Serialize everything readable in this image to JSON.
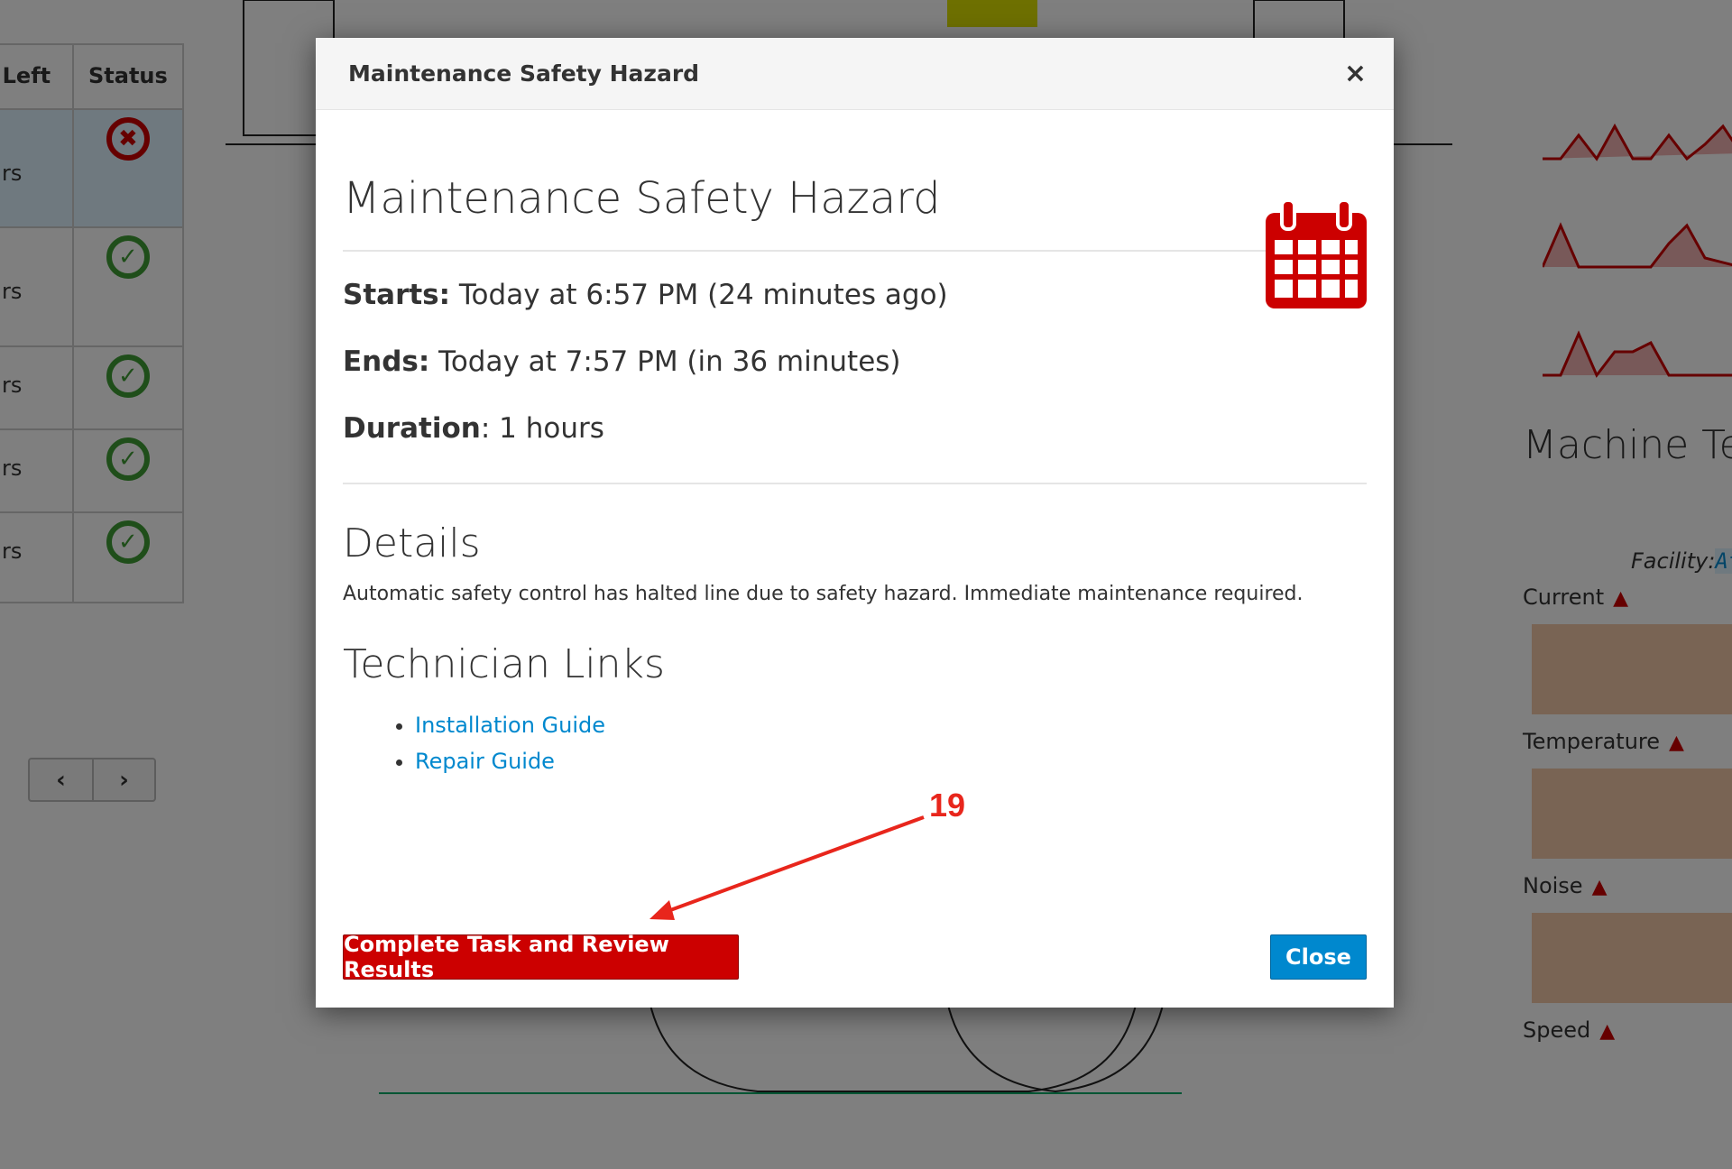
{
  "background": {
    "table": {
      "headers": [
        "e Left",
        "Status"
      ],
      "rows": [
        {
          "time": "rs",
          "status": "error"
        },
        {
          "time": "rs",
          "status": "ok"
        },
        {
          "time": "rs",
          "status": "ok"
        },
        {
          "time": "rs",
          "status": "ok"
        },
        {
          "time": "rs",
          "status": "ok"
        }
      ]
    },
    "pager": {
      "prev": "‹",
      "next": "›"
    },
    "right_panel": {
      "title": "Machine Tel",
      "facility_label": "Facility:",
      "facility_value": "At",
      "metrics": [
        "Current",
        "Temperature",
        "Noise",
        "Speed"
      ]
    }
  },
  "modal": {
    "header_title": "Maintenance Safety Hazard",
    "close_x": "×",
    "title": "Maintenance Safety Hazard",
    "icon": "calendar-icon",
    "starts_label": "Starts:",
    "starts_value": " Today at 6:57 PM (24 minutes ago)",
    "ends_label": "Ends:",
    "ends_value": " Today at 7:57 PM (in 36 minutes)",
    "duration_label": "Duration",
    "duration_value": ": 1 hours",
    "details_heading": "Details",
    "details_text": "Automatic safety control has halted line due to safety hazard. Immediate maintenance required.",
    "links_heading": "Technician Links",
    "links": [
      "Installation Guide",
      "Repair Guide"
    ],
    "complete_button": "Complete Task and Review Results",
    "close_button": "Close"
  },
  "annotation": {
    "label": "19",
    "color": "#e8261c"
  },
  "colors": {
    "danger": "#cc0000",
    "primary": "#0088ce",
    "ok": "#3f9c35"
  }
}
